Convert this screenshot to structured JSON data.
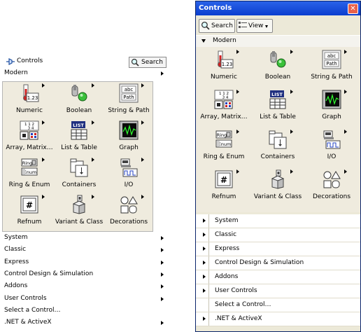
{
  "left_menu": {
    "title": "Controls",
    "search_label": "Search",
    "current_palette": "Modern",
    "palette_items": [
      {
        "label": "Numeric",
        "icon": "numeric-icon"
      },
      {
        "label": "Boolean",
        "icon": "boolean-icon"
      },
      {
        "label": "String & Path",
        "icon": "string-path-icon"
      },
      {
        "label": "Array, Matrix…",
        "icon": "array-matrix-icon"
      },
      {
        "label": "List & Table",
        "icon": "list-table-icon"
      },
      {
        "label": "Graph",
        "icon": "graph-icon"
      },
      {
        "label": "Ring & Enum",
        "icon": "ring-enum-icon"
      },
      {
        "label": "Containers",
        "icon": "containers-icon"
      },
      {
        "label": "I/O",
        "icon": "io-icon"
      },
      {
        "label": "Refnum",
        "icon": "refnum-icon"
      },
      {
        "label": "Variant & Class",
        "icon": "variant-class-icon"
      },
      {
        "label": "Decorations",
        "icon": "decorations-icon"
      }
    ],
    "categories": [
      {
        "label": "System",
        "submenu": true
      },
      {
        "label": "Classic",
        "submenu": true
      },
      {
        "label": "Express",
        "submenu": true
      },
      {
        "label": "Control Design & Simulation",
        "submenu": true
      },
      {
        "label": "Addons",
        "submenu": true
      },
      {
        "label": "User Controls",
        "submenu": true
      },
      {
        "label": "Select a Control…",
        "submenu": false
      },
      {
        "label": ".NET & ActiveX",
        "submenu": true
      }
    ]
  },
  "right_window": {
    "title": "Controls",
    "toolbar": {
      "search_label": "Search",
      "view_label": "View"
    },
    "expanded_category": "Modern",
    "palette_items": [
      {
        "label": "Numeric",
        "icon": "numeric-icon"
      },
      {
        "label": "Boolean",
        "icon": "boolean-icon"
      },
      {
        "label": "String & Path",
        "icon": "string-path-icon"
      },
      {
        "label": "Array, Matrix…",
        "icon": "array-matrix-icon"
      },
      {
        "label": "List & Table",
        "icon": "list-table-icon"
      },
      {
        "label": "Graph",
        "icon": "graph-icon"
      },
      {
        "label": "Ring & Enum",
        "icon": "ring-enum-icon"
      },
      {
        "label": "Containers",
        "icon": "containers-icon"
      },
      {
        "label": "I/O",
        "icon": "io-icon"
      },
      {
        "label": "Refnum",
        "icon": "refnum-icon"
      },
      {
        "label": "Variant & Class",
        "icon": "variant-class-icon"
      },
      {
        "label": "Decorations",
        "icon": "decorations-icon"
      }
    ],
    "categories": [
      {
        "label": "System",
        "expandable": true
      },
      {
        "label": "Classic",
        "expandable": true
      },
      {
        "label": "Express",
        "expandable": true
      },
      {
        "label": "Control Design & Simulation",
        "expandable": true
      },
      {
        "label": "Addons",
        "expandable": true
      },
      {
        "label": "User Controls",
        "expandable": true
      },
      {
        "label": "Select a Control…",
        "expandable": false
      },
      {
        "label": ".NET & ActiveX",
        "expandable": true
      }
    ]
  },
  "icon_text": {
    "numeric": "1.23",
    "string_abc": "abc",
    "string_path": "Path",
    "list": "LIST",
    "ring": "Ring",
    "enum": "Enum",
    "array_a": "1 1 2",
    "array_b": "3 4"
  },
  "colors": {
    "palette_bg": "#efebde",
    "window_bg": "#ece9d8",
    "titlebar": "#0a3ecf",
    "close": "#e8614a"
  }
}
